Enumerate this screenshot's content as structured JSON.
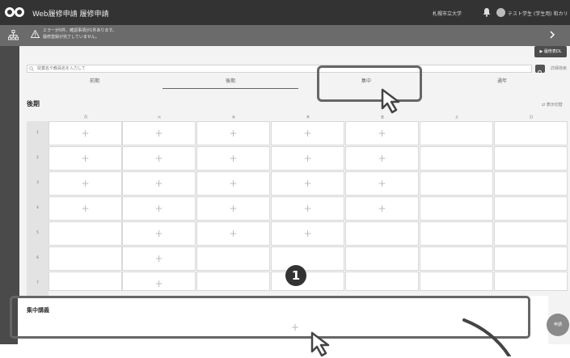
{
  "header": {
    "app_title": "Web履修申請 履修申請",
    "university": "札幌市立大学",
    "user_name": "テスト学生 (学生用) 和カリ"
  },
  "banner": {
    "line1": "エラーが0件、確認事項が1件あります。",
    "line2": "履修登録が完了していません。"
  },
  "toolbar": {
    "download_label": "履修表DL"
  },
  "search": {
    "placeholder": "授業名や教員名を入力して",
    "detail_label": "詳細検索"
  },
  "tabs": [
    "前期",
    "後期",
    "集中",
    "通年"
  ],
  "active_tab": 1,
  "section": {
    "title": "後期",
    "toggle_label": "表示切替"
  },
  "timetable": {
    "days": [
      "月",
      "火",
      "水",
      "木",
      "金",
      "土",
      "日"
    ],
    "periods": [
      "1",
      "2",
      "3",
      "4",
      "5",
      "6",
      "7"
    ],
    "add_symbol": "+",
    "rows": [
      [
        "+",
        "+",
        "+",
        "+",
        "+",
        "",
        ""
      ],
      [
        "+",
        "+",
        "+",
        "+",
        "+",
        "",
        ""
      ],
      [
        "+",
        "+",
        "+",
        "+",
        "+",
        "",
        ""
      ],
      [
        "+",
        "+",
        "+",
        "+",
        "+",
        "",
        ""
      ],
      [
        "",
        "+",
        "+",
        "+",
        "",
        "",
        ""
      ],
      [
        "",
        "+",
        "",
        "",
        "",
        "",
        ""
      ],
      [
        "",
        "+",
        "",
        "",
        "",
        "",
        ""
      ]
    ]
  },
  "concentrated": {
    "title": "集中講義",
    "add_symbol": "+"
  },
  "fab_label": "申請",
  "annotation": {
    "step_number": "1"
  }
}
